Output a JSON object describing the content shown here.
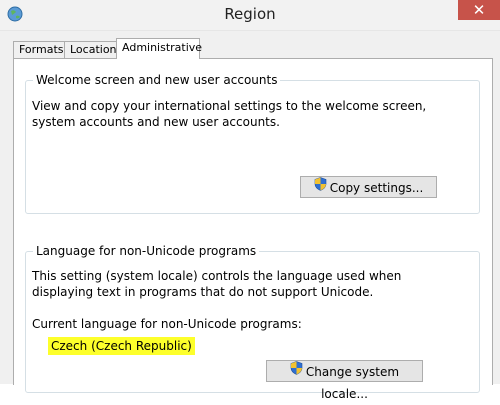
{
  "window": {
    "title": "Region",
    "app_icon": "globe-icon",
    "close_label": "✕"
  },
  "tabs": [
    {
      "label": "Formats"
    },
    {
      "label": "Location"
    },
    {
      "label": "Administrative"
    }
  ],
  "welcome_group": {
    "title": "Welcome screen and new user accounts",
    "description": "View and copy your international settings to the welcome screen, system accounts and new user accounts.",
    "button_label": "Copy settings...",
    "button_icon": "uac-shield-icon"
  },
  "locale_group": {
    "title": "Language for non-Unicode programs",
    "description": "This setting (system locale) controls the language used when displaying text in programs that do not support Unicode.",
    "current_label": "Current language for non-Unicode programs:",
    "current_value": "Czech (Czech Republic)",
    "highlight_color": "#fdff2b",
    "button_label": "Change system locale...",
    "button_icon": "uac-shield-icon"
  },
  "colors": {
    "close_button": "#c7534a",
    "window_background": "#f0f0f0"
  }
}
